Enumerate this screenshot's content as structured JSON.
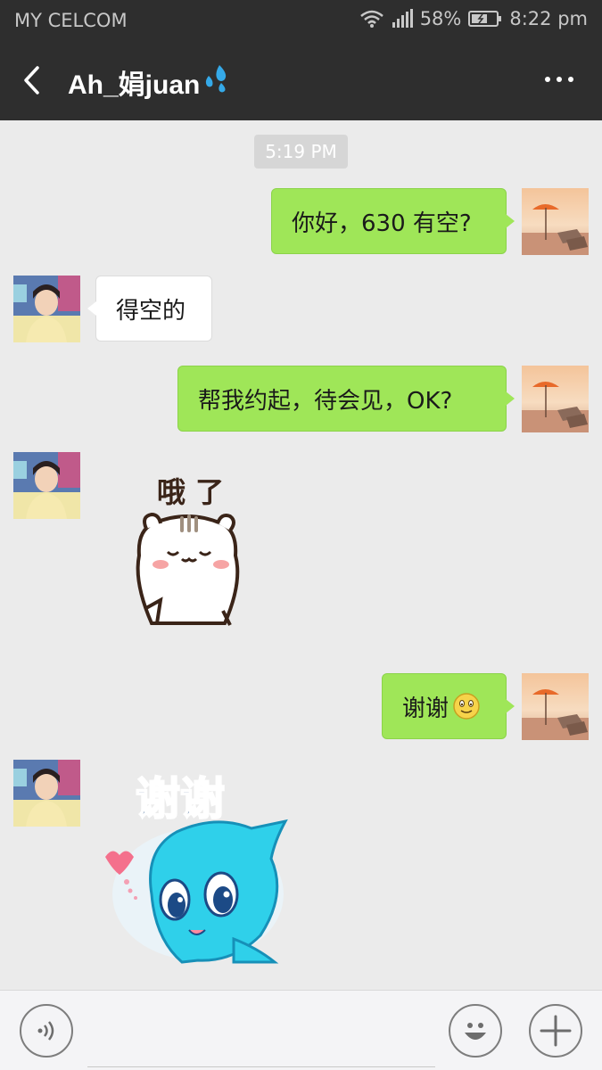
{
  "status_bar": {
    "carrier": "MY CELCOM",
    "battery": "58%",
    "time": "8:22 pm"
  },
  "header": {
    "title": "Ah_娟juan",
    "back_icon": "chevron-left-icon",
    "more_icon": "more-dots-icon"
  },
  "chat": {
    "timestamp": "5:19 PM",
    "messages": [
      {
        "side": "out",
        "type": "text",
        "text": "你好，630 有空?"
      },
      {
        "side": "in",
        "type": "text",
        "text": "得空的"
      },
      {
        "side": "out",
        "type": "text",
        "text": "帮我约起，待会见，OK?"
      },
      {
        "side": "in",
        "type": "sticker",
        "sticker": "cat-sticker",
        "caption": "哦 了"
      },
      {
        "side": "out",
        "type": "text",
        "text": "谢谢",
        "emoji": "smile-emoji"
      },
      {
        "side": "in",
        "type": "sticker",
        "sticker": "blue-creature-sticker",
        "caption": "谢谢"
      }
    ]
  },
  "input_bar": {
    "voice_icon": "voice-icon",
    "emoji_icon": "emoji-icon",
    "plus_icon": "plus-icon"
  },
  "colors": {
    "header_bg": "#2e2e2e",
    "chat_bg": "#ebebeb",
    "outgoing_bubble": "#9fe658",
    "incoming_bubble": "#ffffff"
  }
}
